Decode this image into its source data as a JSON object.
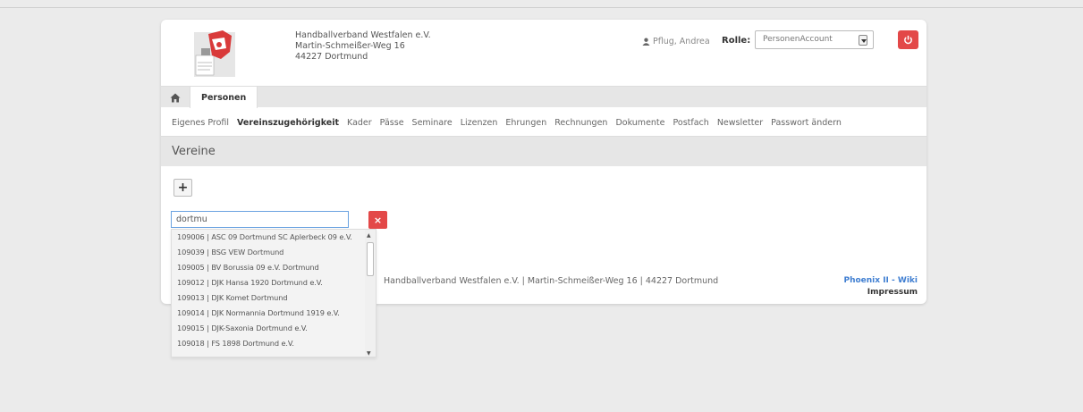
{
  "header": {
    "org_name": "Handballverband Westfalen e.V.",
    "street": "Martin-Schmeißer-Weg 16",
    "city": "44227 Dortmund",
    "user_name": "Pflug, Andrea",
    "role_label": "Rolle:",
    "role_value": "PersonenAccount"
  },
  "nav": {
    "main_tab": "Personen",
    "subnav": [
      "Eigenes Profil",
      "Vereinszugehörigkeit",
      "Kader",
      "Pässe",
      "Seminare",
      "Lizenzen",
      "Ehrungen",
      "Rechnungen",
      "Dokumente",
      "Postfach",
      "Newsletter",
      "Passwort ändern"
    ],
    "active_subnav": "Vereinszugehörigkeit"
  },
  "section": {
    "title": "Vereine",
    "add_label": "+"
  },
  "search": {
    "value": "dortmu",
    "clear_label": "×",
    "results": [
      "109006 | ASC 09 Dortmund SC Aplerbeck 09 e.V.",
      "109039 | BSG VEW Dortmund",
      "109005 | BV Borussia 09 e.V. Dortmund",
      "109012 | DJK Hansa 1920 Dortmund e.V.",
      "109013 | DJK Komet Dortmund",
      "109014 | DJK Normannia Dortmund 1919 e.V.",
      "109015 | DJK-Saxonia Dortmund e.V.",
      "109018 | FS 1898 Dortmund e.V."
    ]
  },
  "footer": {
    "text": "Handballverband Westfalen e.V. | Martin-Schmeißer-Weg 16 | 44227 Dortmund",
    "wiki": "Phoenix II - Wiki",
    "impressum": "Impressum"
  },
  "colors": {
    "accent_red": "#e34848",
    "link_blue": "#3f7ed1",
    "bar_gray": "#e6e6e6"
  },
  "icons": {
    "user": "user-icon",
    "logout": "power-icon",
    "home": "home-icon"
  }
}
